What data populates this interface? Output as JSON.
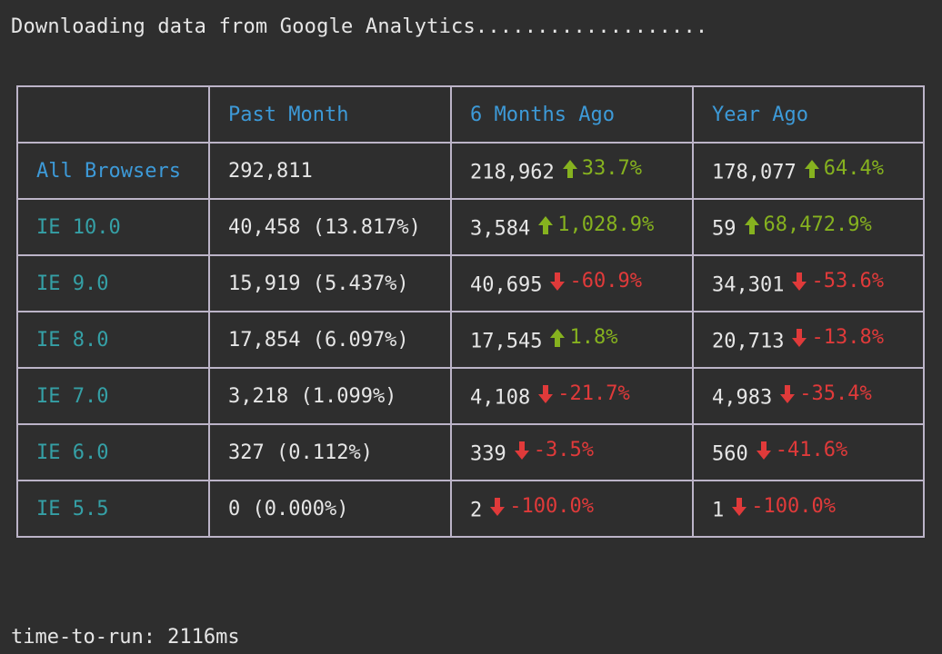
{
  "header": {
    "text": "Downloading data from Google Analytics..................."
  },
  "footer": {
    "text": "time-to-run: 2116ms"
  },
  "colors": {
    "up": "#86b21f",
    "down": "#e03a3a",
    "header": "#3d9ad8",
    "browser": "#35a0a6",
    "border": "#bcb4c8"
  },
  "table": {
    "columns": [
      "",
      "Past Month",
      "6 Months Ago",
      "Year Ago"
    ],
    "rows": [
      {
        "browser": "All Browsers",
        "past": "292,811",
        "six": {
          "value": "218,962",
          "dir": "up",
          "change": "33.7%",
          "icon": "arrow-up-icon"
        },
        "year": {
          "value": "178,077",
          "dir": "up",
          "change": "64.4%",
          "icon": "arrow-up-icon"
        }
      },
      {
        "browser": "IE 10.0",
        "past": "40,458 (13.817%)",
        "six": {
          "value": "3,584",
          "dir": "up",
          "change": "1,028.9%",
          "icon": "arrow-up-icon"
        },
        "year": {
          "value": "59",
          "dir": "up",
          "change": "68,472.9%",
          "icon": "arrow-up-icon"
        }
      },
      {
        "browser": "IE 9.0",
        "past": "15,919 (5.437%)",
        "six": {
          "value": "40,695",
          "dir": "down",
          "change": "-60.9%",
          "icon": "arrow-down-icon"
        },
        "year": {
          "value": "34,301",
          "dir": "down",
          "change": "-53.6%",
          "icon": "arrow-down-icon"
        }
      },
      {
        "browser": "IE 8.0",
        "past": "17,854 (6.097%)",
        "six": {
          "value": "17,545",
          "dir": "up",
          "change": "1.8%",
          "icon": "arrow-up-icon"
        },
        "year": {
          "value": "20,713",
          "dir": "down",
          "change": "-13.8%",
          "icon": "arrow-down-icon"
        }
      },
      {
        "browser": "IE 7.0",
        "past": "3,218 (1.099%)",
        "six": {
          "value": "4,108",
          "dir": "down",
          "change": "-21.7%",
          "icon": "arrow-down-icon"
        },
        "year": {
          "value": "4,983",
          "dir": "down",
          "change": "-35.4%",
          "icon": "arrow-down-icon"
        }
      },
      {
        "browser": "IE 6.0",
        "past": "327 (0.112%)",
        "six": {
          "value": "339",
          "dir": "down",
          "change": "-3.5%",
          "icon": "arrow-down-icon"
        },
        "year": {
          "value": "560",
          "dir": "down",
          "change": "-41.6%",
          "icon": "arrow-down-icon"
        }
      },
      {
        "browser": "IE 5.5",
        "past": "0 (0.000%)",
        "six": {
          "value": "2",
          "dir": "down",
          "change": "-100.0%",
          "icon": "arrow-down-icon"
        },
        "year": {
          "value": "1",
          "dir": "down",
          "change": "-100.0%",
          "icon": "arrow-down-icon"
        }
      }
    ]
  }
}
